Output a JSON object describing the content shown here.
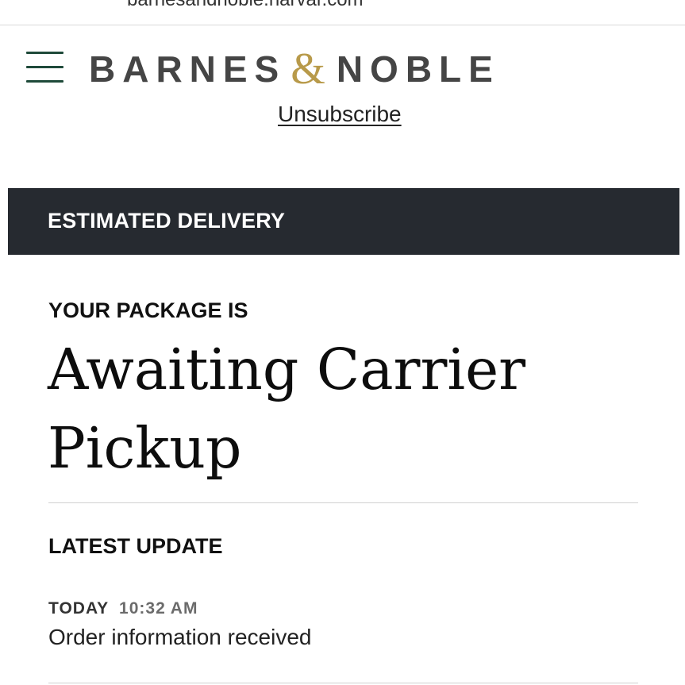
{
  "browser": {
    "url": "barnesandnoble.narvar.com"
  },
  "header": {
    "menu_icon": "hamburger-menu-icon",
    "logo": {
      "word_left": "BARNES",
      "ampersand": "&",
      "word_right": "NOBLE",
      "text_color": "#454545",
      "ampersand_color": "#b89a4a"
    },
    "unsubscribe_label": "Unsubscribe"
  },
  "banner": {
    "title": "ESTIMATED DELIVERY",
    "background": "#262a30"
  },
  "package": {
    "label": "YOUR PACKAGE IS",
    "status": "Awaiting Carrier Pickup"
  },
  "latest_update": {
    "label": "LATEST UPDATE",
    "day": "TODAY",
    "time": "10:32 AM",
    "description": "Order information received"
  }
}
